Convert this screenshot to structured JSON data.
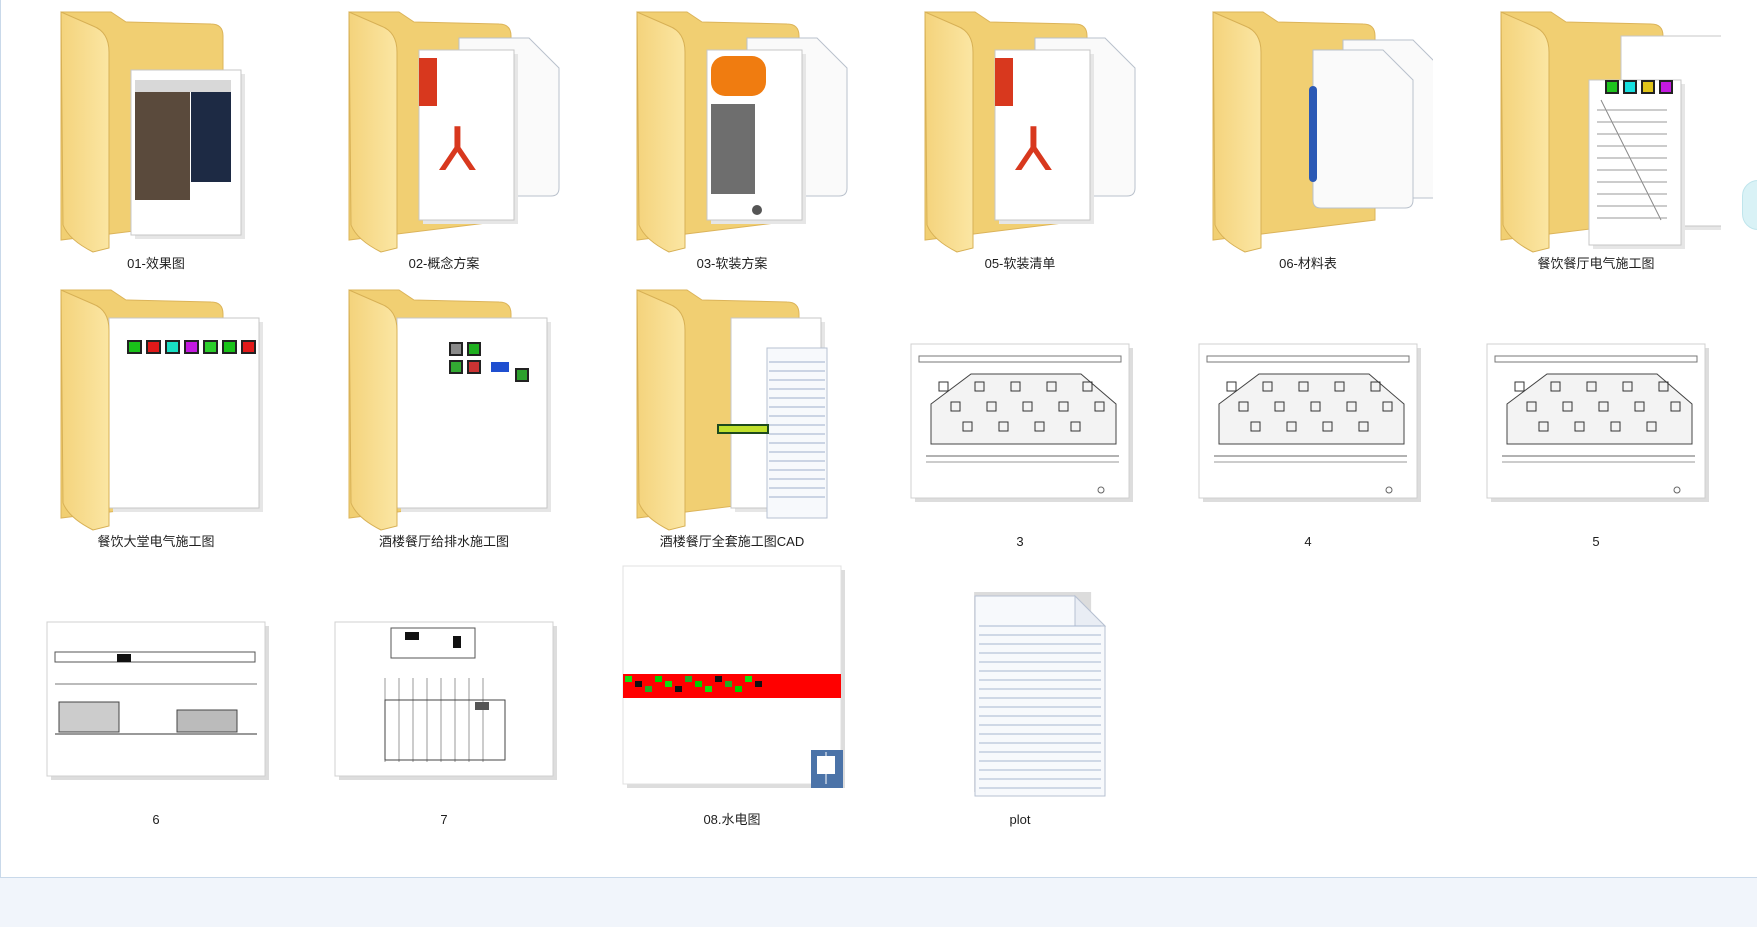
{
  "window": {
    "view": "large-icons"
  },
  "items": [
    {
      "label": "01-效果图",
      "type": "folder",
      "preview": "photo"
    },
    {
      "label": "02-概念方案",
      "type": "folder",
      "preview": "pdf"
    },
    {
      "label": "03-软装方案",
      "type": "folder",
      "preview": "image-doc"
    },
    {
      "label": "05-软装清单",
      "type": "folder",
      "preview": "pdf"
    },
    {
      "label": "06-材料表",
      "type": "folder",
      "preview": "doc"
    },
    {
      "label": "餐饮餐厅电气施工图",
      "type": "folder",
      "preview": "cad-sheet"
    },
    {
      "label": "餐饮大堂电气施工图",
      "type": "folder",
      "preview": "cad-strip"
    },
    {
      "label": "酒楼餐厅给排水施工图",
      "type": "folder",
      "preview": "cad-blocks"
    },
    {
      "label": "酒楼餐厅全套施工图CAD",
      "type": "folder",
      "preview": "notepad"
    },
    {
      "label": "3",
      "type": "dwg-thumb",
      "preview": "plan"
    },
    {
      "label": "4",
      "type": "dwg-thumb",
      "preview": "plan"
    },
    {
      "label": "5",
      "type": "dwg-thumb",
      "preview": "plan"
    },
    {
      "label": "6",
      "type": "dwg-thumb",
      "preview": "elevation"
    },
    {
      "label": "7",
      "type": "dwg-thumb",
      "preview": "section"
    },
    {
      "label": "08.水电图",
      "type": "dwg-thumb",
      "preview": "red-band"
    },
    {
      "label": "plot",
      "type": "text-file",
      "preview": "notepad"
    }
  ],
  "colors": {
    "folder_back": "#f1cf72",
    "folder_front": "#f9df8f",
    "selection": "#cce8ff",
    "pdf_red": "#d8381e",
    "accent_orange": "#f07c10",
    "drawing_red": "#ff0000"
  }
}
